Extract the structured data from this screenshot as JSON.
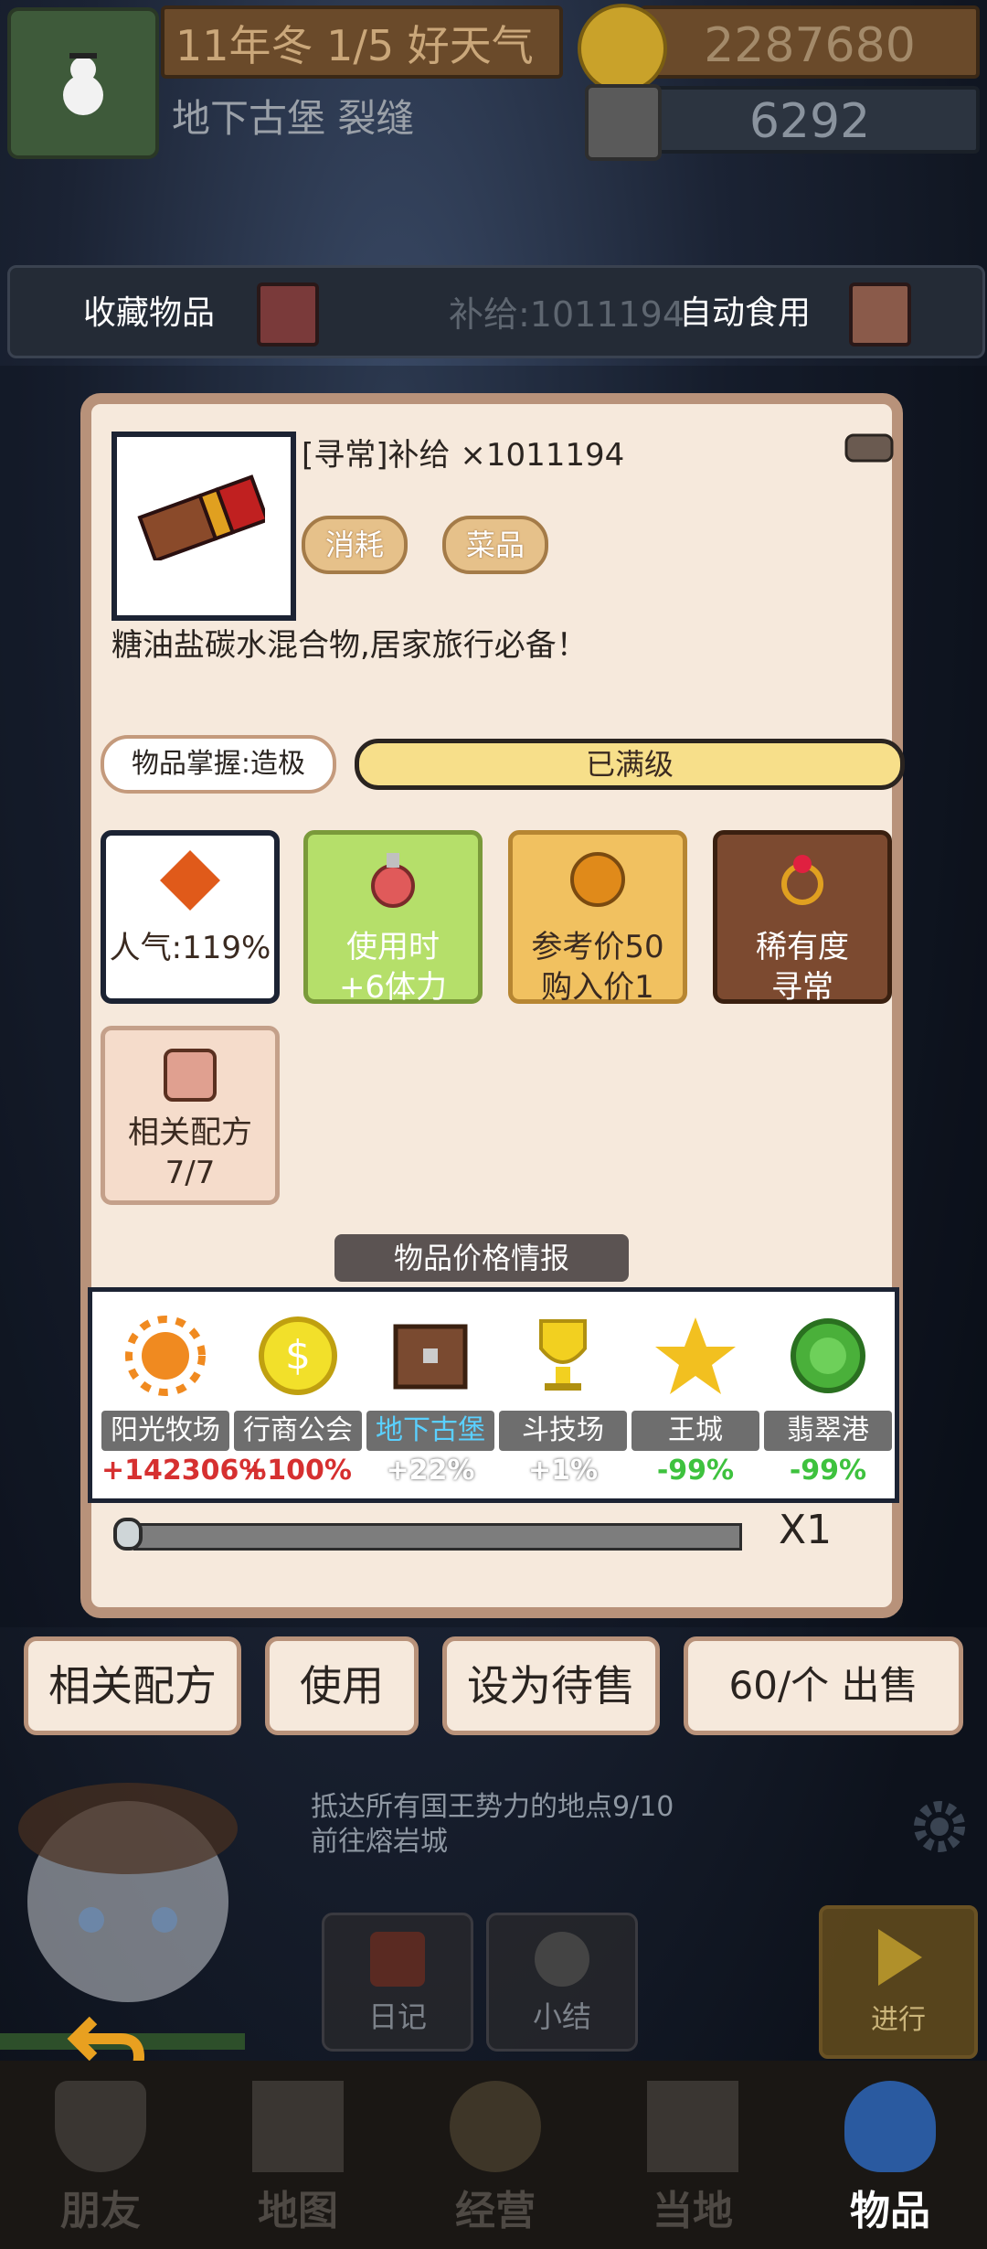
{
  "header": {
    "date": "11年冬 1/5 好天气",
    "location": "地下古堡 裂缝",
    "coins": "2287680",
    "gems": "6292"
  },
  "filter": {
    "collect_label": "收藏物品",
    "supply_text": "补给:1011194",
    "auto_eat_label": "自动食用"
  },
  "item": {
    "title": "[寻常]补给 ×1011194",
    "tags": [
      "消耗",
      "菜品"
    ],
    "description": "糖油盐碳水混合物,居家旅行必备！",
    "mastery_label": "物品掌握:造极",
    "mastery_value": "已满级",
    "popularity": "人气:119%",
    "use_line1": "使用时",
    "use_line2": "+6体力",
    "price_line1": "参考价50",
    "price_line2": "购入价1",
    "rarity_line1": "稀有度",
    "rarity_line2": "寻常",
    "recipe_line1": "相关配方",
    "recipe_line2": "7/7",
    "price_info_header": "物品价格情报",
    "quantity": "X1",
    "quantity_fraction": 0.0
  },
  "markets": [
    {
      "name": "阳光牧场",
      "pct": "+142306%",
      "color": "#d63030",
      "icon": "sun-icon"
    },
    {
      "name": "行商公会",
      "pct": "+100%",
      "color": "#d63030",
      "icon": "coin-icon"
    },
    {
      "name": "地下古堡",
      "pct": "+22%",
      "color": "#ffffff",
      "icon": "chest-icon"
    },
    {
      "name": "斗技场",
      "pct": "+1%",
      "color": "#ffffff",
      "icon": "trophy-icon"
    },
    {
      "name": "王城",
      "pct": "-99%",
      "color": "#3ec23e",
      "icon": "star-icon"
    },
    {
      "name": "翡翠港",
      "pct": "-99%",
      "color": "#3ec23e",
      "icon": "emerald-icon"
    }
  ],
  "actions": {
    "recipe": "相关配方",
    "use": "使用",
    "set_sale": "设为待售",
    "sell": "60/个 出售"
  },
  "quest": {
    "line1": "抵达所有国王势力的地点9/10",
    "line2": "前往熔岩城"
  },
  "side_buttons": {
    "diary": "日记",
    "summary": "小结",
    "proceed": "进行"
  },
  "nav": {
    "friends": "朋友",
    "map": "地图",
    "business": "经营",
    "local": "当地",
    "items": "物品"
  }
}
